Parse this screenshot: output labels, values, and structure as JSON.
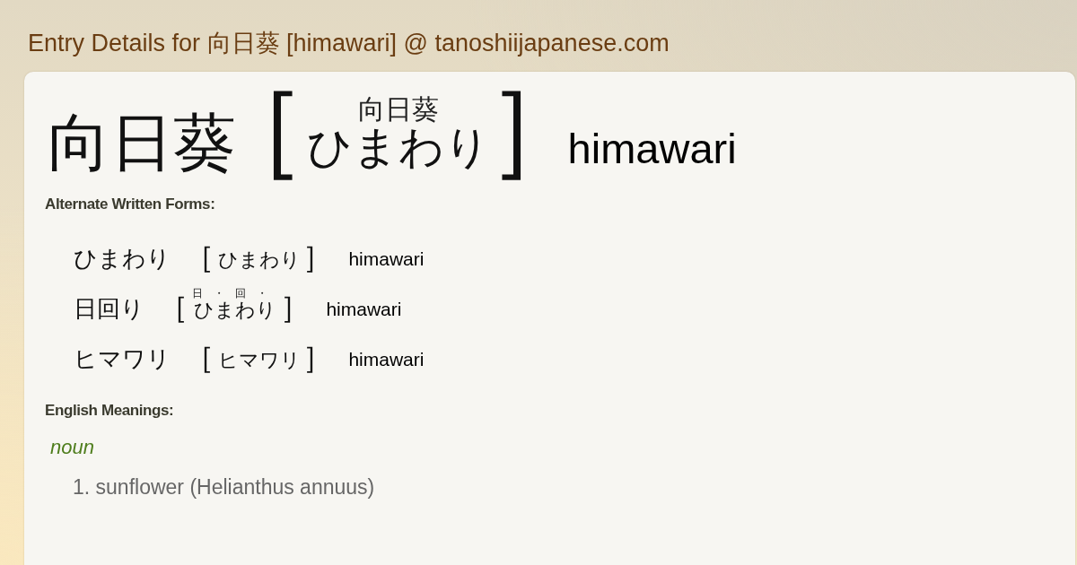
{
  "page_title": "Entry Details for 向日葵 [himawari] @ tanoshiijapanese.com",
  "entry": {
    "word": "向日葵",
    "reading": {
      "open": "［",
      "kana": "ひまわり",
      "ruby": "向日葵",
      "close": "］"
    },
    "romaji": "himawari"
  },
  "alternate_forms": {
    "heading": "Alternate Written Forms:",
    "items": [
      {
        "word": "ひまわり",
        "reading": {
          "open": "［",
          "kana": "ひまわり",
          "close": "］"
        },
        "romaji": "himawari"
      },
      {
        "word": "日回り",
        "reading": {
          "open": "［",
          "kana": "ひまわり",
          "ruby": "日・回・",
          "close": "］"
        },
        "romaji": "himawari"
      },
      {
        "word": "ヒマワリ",
        "reading": {
          "open": "［",
          "kana": "ヒマワリ",
          "close": "］"
        },
        "romaji": "himawari"
      }
    ]
  },
  "meanings": {
    "heading": "English Meanings:",
    "groups": [
      {
        "part_of_speech": "noun",
        "senses": [
          "1. sunflower (Helianthus annuus)"
        ]
      }
    ]
  }
}
